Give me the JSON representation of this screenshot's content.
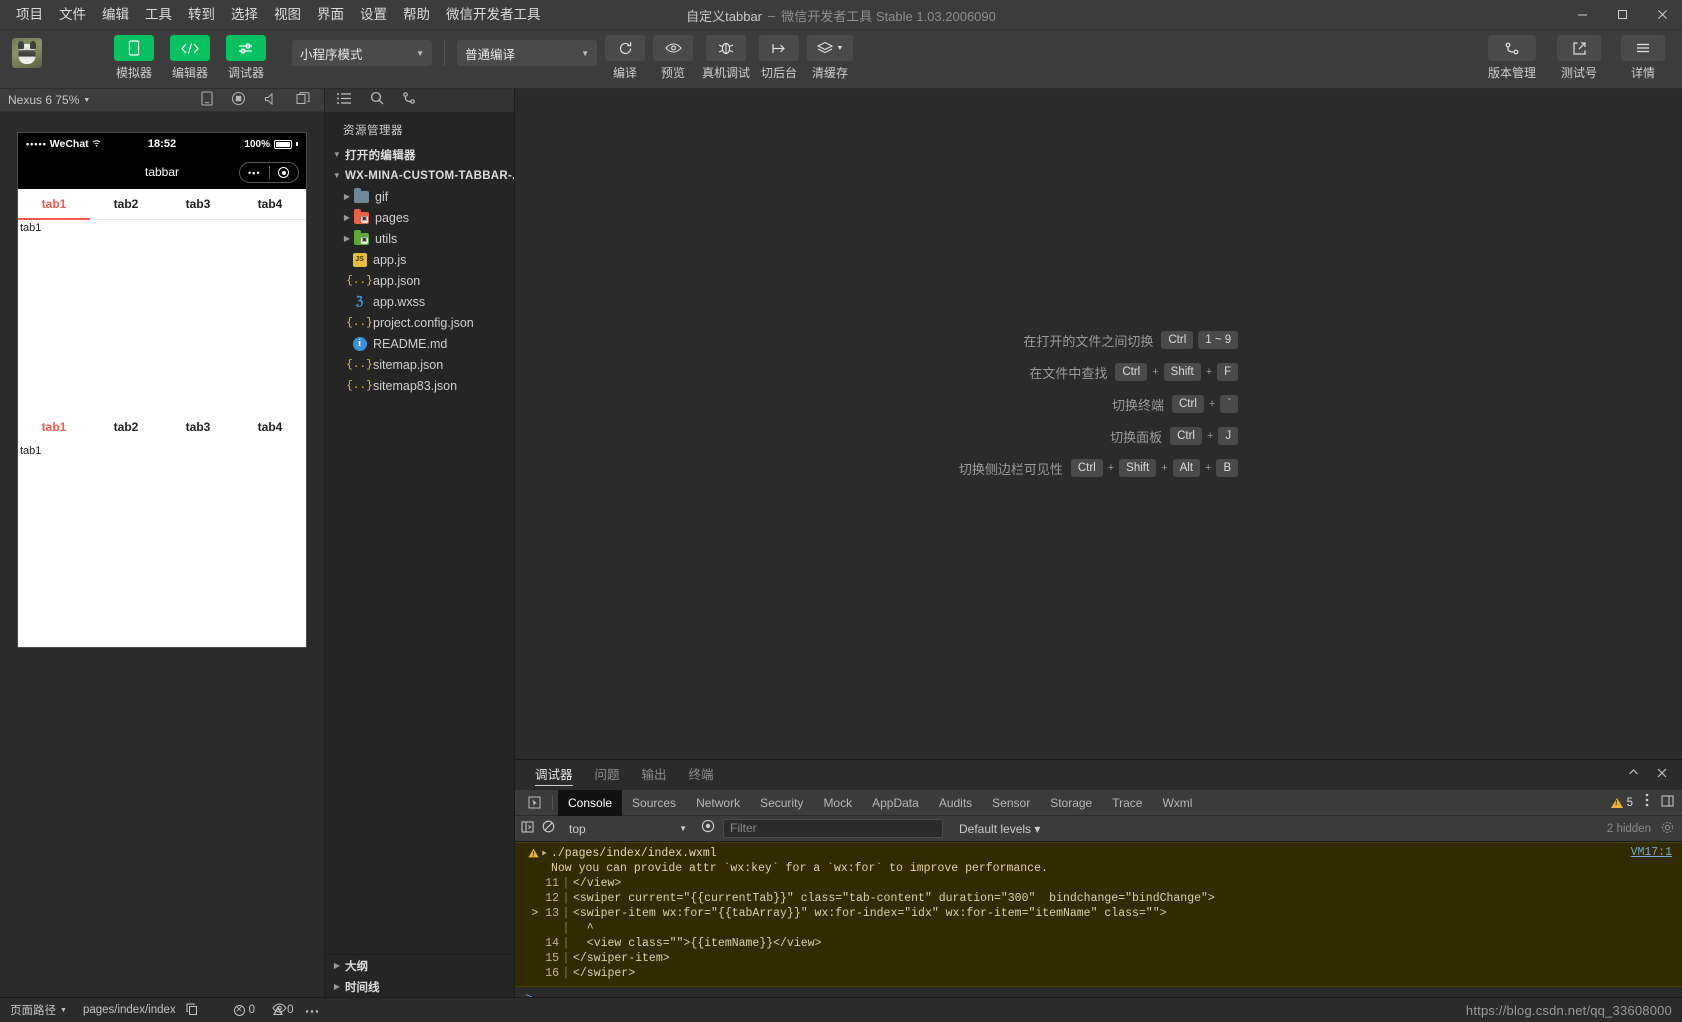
{
  "window": {
    "title_main": "自定义tabbar",
    "title_dash": "–",
    "title_sub": "微信开发者工具 Stable 1.03.2006090"
  },
  "menubar": [
    "项目",
    "文件",
    "编辑",
    "工具",
    "转到",
    "选择",
    "视图",
    "界面",
    "设置",
    "帮助",
    "微信开发者工具"
  ],
  "toolbar": {
    "left_buttons": [
      {
        "label": "模拟器",
        "icon": "phone-icon",
        "active": true
      },
      {
        "label": "编辑器",
        "icon": "code-icon",
        "active": true
      },
      {
        "label": "调试器",
        "icon": "sliders-icon",
        "active": true
      }
    ],
    "mode_select": "小程序模式",
    "build_select": "普通编译",
    "mid_buttons": [
      {
        "label": "编译",
        "icon": "refresh-icon"
      },
      {
        "label": "预览",
        "icon": "eye-icon"
      },
      {
        "label": "真机调试",
        "icon": "bug-icon"
      },
      {
        "label": "切后台",
        "icon": "background-icon"
      },
      {
        "label": "清缓存",
        "icon": "layers-icon"
      }
    ],
    "right_buttons": [
      {
        "label": "版本管理",
        "icon": "branch-icon"
      },
      {
        "label": "测试号",
        "icon": "external-link-icon"
      },
      {
        "label": "详情",
        "icon": "menu-icon"
      }
    ]
  },
  "simulator": {
    "device": "Nexus 6 75%",
    "status_bar": {
      "dots": "•••••",
      "carrier": "WeChat",
      "time": "18:52",
      "battery": "100%"
    },
    "nav_title": "tabbar",
    "tabs": [
      "tab1",
      "tab2",
      "tab3",
      "tab4"
    ],
    "active_tab_index": 0,
    "page_text_top": "tab1",
    "page_text_bottom": "tab1"
  },
  "explorer": {
    "title": "资源管理器",
    "open_editors": "打开的编辑器",
    "project_root": "WX-MINA-CUSTOM-TABBAR-...",
    "items": [
      {
        "label": "gif",
        "type": "folder",
        "color": "blue",
        "expandable": true
      },
      {
        "label": "pages",
        "type": "folder",
        "color": "orange",
        "expandable": true
      },
      {
        "label": "utils",
        "type": "folder",
        "color": "green",
        "expandable": true
      },
      {
        "label": "app.js",
        "type": "js"
      },
      {
        "label": "app.json",
        "type": "json"
      },
      {
        "label": "app.wxss",
        "type": "wxss"
      },
      {
        "label": "project.config.json",
        "type": "json"
      },
      {
        "label": "README.md",
        "type": "md"
      },
      {
        "label": "sitemap.json",
        "type": "json"
      },
      {
        "label": "sitemap83.json",
        "type": "json"
      }
    ],
    "bottom_sections": [
      "大纲",
      "时间线"
    ]
  },
  "editor": {
    "shortcuts": [
      {
        "label": "在打开的文件之间切换",
        "keys": [
          "Ctrl",
          "1 ~ 9"
        ],
        "seps": [
          ""
        ]
      },
      {
        "label": "在文件中查找",
        "keys": [
          "Ctrl",
          "Shift",
          "F"
        ],
        "seps": [
          "+",
          "+"
        ]
      },
      {
        "label": "切换终端",
        "keys": [
          "Ctrl",
          "`"
        ],
        "seps": [
          "+"
        ]
      },
      {
        "label": "切换面板",
        "keys": [
          "Ctrl",
          "J"
        ],
        "seps": [
          "+"
        ]
      },
      {
        "label": "切换侧边栏可见性",
        "keys": [
          "Ctrl",
          "Shift",
          "Alt",
          "B"
        ],
        "seps": [
          "+",
          "+",
          "+"
        ]
      }
    ]
  },
  "debugger": {
    "tabs": [
      "调试器",
      "问题",
      "输出",
      "终端"
    ],
    "active_tab": "调试器",
    "devtools_tabs": [
      "Console",
      "Sources",
      "Network",
      "Security",
      "Mock",
      "AppData",
      "Audits",
      "Sensor",
      "Storage",
      "Trace",
      "Wxml"
    ],
    "active_devtools_tab": "Console",
    "warning_count": "5",
    "context": "top",
    "filter_placeholder": "Filter",
    "levels": "Default levels ▾",
    "hidden_text": "2 hidden",
    "console": {
      "source": "./pages/index/index.wxml",
      "message": "Now you can provide attr `wx:key` for a `wx:for` to improve performance.",
      "vm_link": "VM17:1",
      "lines": [
        {
          "num": "11",
          "marker": "",
          "code": "</view>"
        },
        {
          "num": "12",
          "marker": "",
          "code": "<swiper current=\"{{currentTab}}\" class=\"tab-content\" duration=\"300\"  bindchange=\"bindChange\">"
        },
        {
          "num": "13",
          "marker": ">",
          "code": "<swiper-item wx:for=\"{{tabArray}}\" wx:for-index=\"idx\" wx:for-item=\"itemName\" class=\"\">"
        },
        {
          "num": "",
          "marker": "",
          "code": "  ^"
        },
        {
          "num": "14",
          "marker": "",
          "code": "  <view class=\"\">{{itemName}}</view>"
        },
        {
          "num": "15",
          "marker": "",
          "code": "</swiper-item>"
        },
        {
          "num": "16",
          "marker": "",
          "code": "</swiper>"
        }
      ]
    }
  },
  "statusbar": {
    "page_path_label": "页面路径",
    "page_path_value": "pages/index/index",
    "error_count": "0",
    "warning_count": "0",
    "watermark": "https://blog.csdn.net/qq_33608000"
  }
}
